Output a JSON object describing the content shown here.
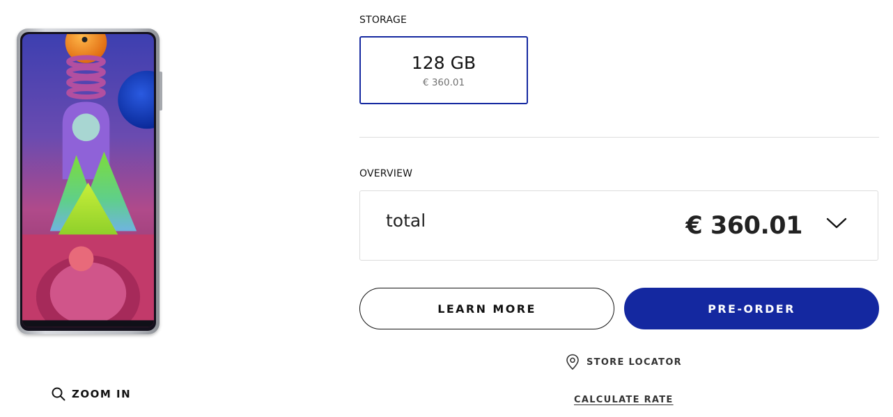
{
  "product": {
    "image_alt": "phone-product-image",
    "zoom_label": "ZOOM IN"
  },
  "storage": {
    "label": "STORAGE",
    "options": [
      {
        "size": "128 GB",
        "price": "€ 360.01",
        "selected": true
      }
    ]
  },
  "overview": {
    "label": "OVERVIEW",
    "total_label": "total",
    "total_price": "€ 360.01"
  },
  "actions": {
    "learn_more": "LEARN MORE",
    "pre_order": "PRE-ORDER",
    "store_locator": "STORE LOCATOR",
    "calculate_rate": "CALCULATE RATE"
  },
  "colors": {
    "brand_blue": "#1428a0",
    "text_dark": "#111111",
    "text_muted": "#707070",
    "border_light": "#dcdcdc"
  }
}
